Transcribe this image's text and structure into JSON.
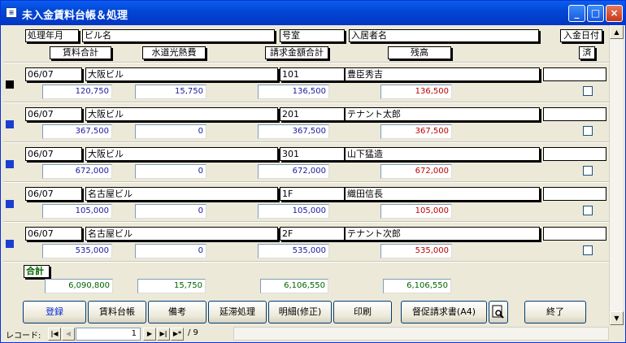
{
  "window": {
    "title": "未入金賃料台帳＆処理",
    "minimize": "_",
    "maximize": "□",
    "close": "×"
  },
  "header": {
    "period": "処理年月",
    "building": "ビル名",
    "room": "号室",
    "tenant": "入居者名",
    "pay_date": "入金日付",
    "rent_total": "賃料合計",
    "utilities": "水道光熱費",
    "billed_total": "請求金額合計",
    "balance": "残高",
    "done": "済"
  },
  "records": [
    {
      "period": "06/07",
      "building": "大阪ビル",
      "room": "101",
      "tenant": "豊臣秀吉",
      "rent": "120,750",
      "utility": "15,750",
      "billed": "136,500",
      "balance": "136,500",
      "selected": true
    },
    {
      "period": "06/07",
      "building": "大阪ビル",
      "room": "201",
      "tenant": "テナント太郎",
      "rent": "367,500",
      "utility": "0",
      "billed": "367,500",
      "balance": "367,500",
      "selected": false
    },
    {
      "period": "06/07",
      "building": "大阪ビル",
      "room": "301",
      "tenant": "山下猛造",
      "rent": "672,000",
      "utility": "0",
      "billed": "672,000",
      "balance": "672,000",
      "selected": false
    },
    {
      "period": "06/07",
      "building": "名古屋ビル",
      "room": "1F",
      "tenant": "織田信長",
      "rent": "105,000",
      "utility": "0",
      "billed": "105,000",
      "balance": "105,000",
      "selected": false
    },
    {
      "period": "06/07",
      "building": "名古屋ビル",
      "room": "2F",
      "tenant": "テナント次郎",
      "rent": "535,000",
      "utility": "0",
      "billed": "535,000",
      "balance": "535,000",
      "selected": false
    }
  ],
  "totals": {
    "label": "合計",
    "rent": "6,090,800",
    "utility": "15,750",
    "billed": "6,106,550",
    "balance": "6,106,550"
  },
  "buttons": {
    "register": "登録",
    "rent_ledger": "賃料台帳",
    "notes": "備考",
    "late_fee": "延滞処理",
    "details": "明細(修正)",
    "print": "印刷",
    "reminder": "督促請求書(A4)",
    "exit": "終了"
  },
  "nav": {
    "label": "レコード:",
    "current": "1",
    "total_text": "/ 9"
  },
  "colors": {
    "selected_marker": "#000000",
    "unselected_marker": "#1a3fd0",
    "balance": "#c00000",
    "totals": "#006400"
  }
}
